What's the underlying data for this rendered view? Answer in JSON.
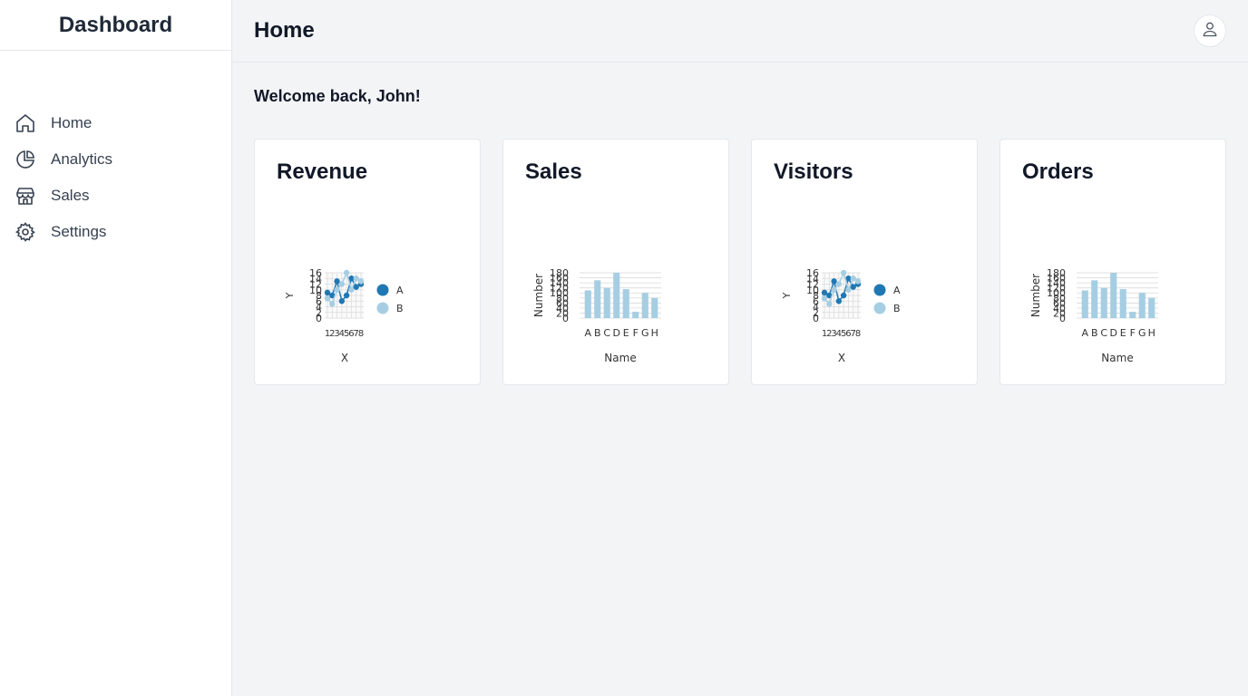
{
  "app": {
    "brand": "Dashboard"
  },
  "sidebar": {
    "items": [
      {
        "label": "Home",
        "icon": "home-icon"
      },
      {
        "label": "Analytics",
        "icon": "pie-chart-icon"
      },
      {
        "label": "Sales",
        "icon": "store-icon"
      },
      {
        "label": "Settings",
        "icon": "gear-icon"
      }
    ]
  },
  "header": {
    "title": "Home",
    "avatar_icon": "user-icon"
  },
  "main": {
    "welcome": "Welcome back, John!"
  },
  "cards": [
    {
      "title": "Revenue"
    },
    {
      "title": "Sales"
    },
    {
      "title": "Visitors"
    },
    {
      "title": "Orders"
    }
  ],
  "colors": {
    "series_a": "#1f78b4",
    "series_b": "#a6cee3",
    "bar": "#a6cee3",
    "grid": "#d9d9d9"
  },
  "chart_data": [
    {
      "type": "line",
      "xlabel": "X",
      "ylabel": "Y",
      "ylim": [
        0,
        16
      ],
      "yticks": [
        0,
        2,
        4,
        6,
        8,
        10,
        12,
        14,
        16
      ],
      "x": [
        1,
        2,
        3,
        4,
        5,
        6,
        7,
        8
      ],
      "series": [
        {
          "name": "A",
          "values": [
            9,
            8,
            13,
            6,
            8,
            14,
            11,
            12
          ]
        },
        {
          "name": "B",
          "values": [
            7,
            5,
            10,
            12,
            16,
            10,
            14,
            13
          ]
        }
      ],
      "legend": "right"
    },
    {
      "type": "bar",
      "xlabel": "Name",
      "ylabel": "Number",
      "ylim": [
        0,
        180
      ],
      "yticks": [
        0,
        20,
        40,
        60,
        80,
        100,
        120,
        140,
        160,
        180
      ],
      "categories": [
        "A",
        "B",
        "C",
        "D",
        "E",
        "F",
        "G",
        "H"
      ],
      "values": [
        110,
        150,
        120,
        180,
        115,
        25,
        100,
        80
      ]
    },
    {
      "type": "line",
      "xlabel": "X",
      "ylabel": "Y",
      "ylim": [
        0,
        16
      ],
      "yticks": [
        0,
        2,
        4,
        6,
        8,
        10,
        12,
        14,
        16
      ],
      "x": [
        1,
        2,
        3,
        4,
        5,
        6,
        7,
        8
      ],
      "series": [
        {
          "name": "A",
          "values": [
            9,
            8,
            13,
            6,
            8,
            14,
            11,
            12
          ]
        },
        {
          "name": "B",
          "values": [
            7,
            5,
            10,
            12,
            16,
            10,
            14,
            13
          ]
        }
      ],
      "legend": "right"
    },
    {
      "type": "bar",
      "xlabel": "Name",
      "ylabel": "Number",
      "ylim": [
        0,
        180
      ],
      "yticks": [
        0,
        20,
        40,
        60,
        80,
        100,
        120,
        140,
        160,
        180
      ],
      "categories": [
        "A",
        "B",
        "C",
        "D",
        "E",
        "F",
        "G",
        "H"
      ],
      "values": [
        110,
        150,
        120,
        180,
        115,
        25,
        100,
        80
      ]
    }
  ]
}
